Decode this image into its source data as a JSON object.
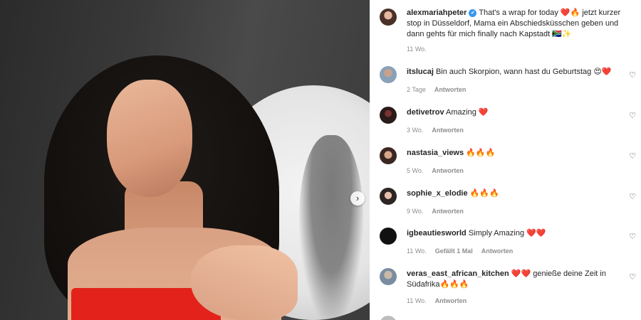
{
  "nav": {
    "next_icon": "›"
  },
  "post": {
    "username": "alexmariahpeter",
    "verified_icon": "✔",
    "caption": "That's a wrap for today ❤️🔥 jetzt kurzer stop in Düsseldorf, Mama ein Abschiedsküsschen geben und dann gehts für mich finally nach Kapstadt 🇿🇦✨",
    "time": "11 Wo."
  },
  "reply_label": "Antworten",
  "comments": [
    {
      "user": "itslucaj",
      "text": "Bin auch Skorpion, wann hast du Geburtstag 😍❤️",
      "time": "2 Tage",
      "likes": ""
    },
    {
      "user": "detivetrov",
      "text": "Amazing ❤️",
      "time": "3 Wo.",
      "likes": ""
    },
    {
      "user": "nastasia_views",
      "text": "🔥🔥🔥",
      "time": "5 Wo.",
      "likes": ""
    },
    {
      "user": "sophie_x_elodie",
      "text": "🔥🔥🔥",
      "time": "9 Wo.",
      "likes": ""
    },
    {
      "user": "igbeautiesworld",
      "text": "Simply Amazing ❤️❤️",
      "time": "11 Wo.",
      "likes": "Gefällt 1 Mal"
    },
    {
      "user": "veras_east_african_kitchen",
      "text": "❤️❤️ genieße deine Zeit in Südafrika🔥🔥🔥",
      "time": "11 Wo.",
      "likes": ""
    }
  ],
  "icons": {
    "heart": "♡"
  }
}
